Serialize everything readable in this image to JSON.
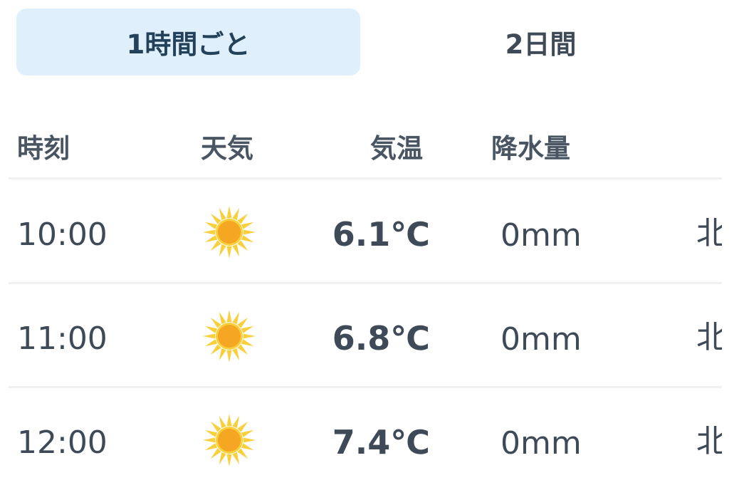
{
  "tabs": [
    {
      "label": "1時間ごと",
      "selected": true
    },
    {
      "label": "2日間",
      "selected": false
    }
  ],
  "headers": {
    "time": "時刻",
    "weather": "天気",
    "temp": "気温",
    "precip": "降水量"
  },
  "rows": [
    {
      "time": "10:00",
      "weather_icon": "sun-icon",
      "temp": "6.1℃",
      "precip": "0mm",
      "wind": "北"
    },
    {
      "time": "11:00",
      "weather_icon": "sun-icon",
      "temp": "6.8℃",
      "precip": "0mm",
      "wind": "北"
    },
    {
      "time": "12:00",
      "weather_icon": "sun-icon",
      "temp": "7.4℃",
      "precip": "0mm",
      "wind": "北"
    }
  ],
  "colors": {
    "tab_selected_bg": "#dff0fc",
    "text": "#3f4a58",
    "sun_ray": "#f9cf3c",
    "sun_core": "#f5a623",
    "divider": "#eef0f2"
  }
}
